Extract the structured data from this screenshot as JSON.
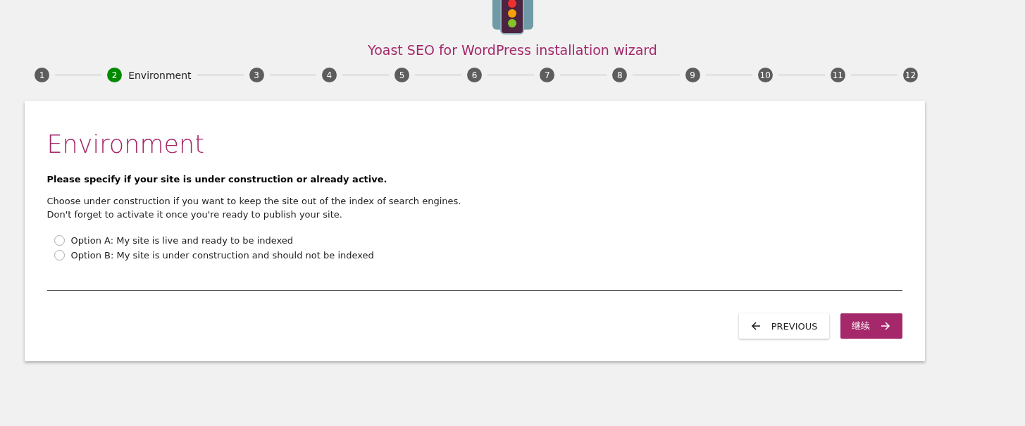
{
  "title": "Yoast SEO for WordPress installation wizard",
  "steps": [
    {
      "number": "1",
      "selected": false
    },
    {
      "number": "2",
      "selected": true,
      "label": "Environment"
    },
    {
      "number": "3",
      "selected": false
    },
    {
      "number": "4",
      "selected": false
    },
    {
      "number": "5",
      "selected": false
    },
    {
      "number": "6",
      "selected": false
    },
    {
      "number": "7",
      "selected": false
    },
    {
      "number": "8",
      "selected": false
    },
    {
      "number": "9",
      "selected": false
    },
    {
      "number": "10",
      "selected": false
    },
    {
      "number": "11",
      "selected": false
    },
    {
      "number": "12",
      "selected": false
    }
  ],
  "card": {
    "heading": "Environment",
    "question": "Please specify if your site is under construction or already active.",
    "description": [
      "Choose under construction if you want to keep the site out of the index of search engines.",
      "Don't forget to activate it once you're ready to publish your site."
    ],
    "options": [
      {
        "label": "Option A: My site is live and ready to be indexed",
        "selected": false
      },
      {
        "label": "Option B: My site is under construction and should not be indexed",
        "selected": false
      }
    ],
    "previous_button": "PREVIOUS",
    "next_button": "继续"
  }
}
